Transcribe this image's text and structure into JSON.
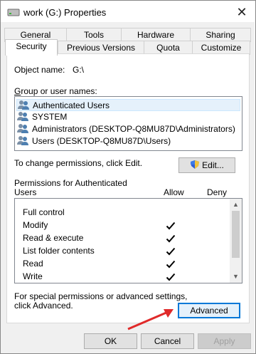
{
  "window": {
    "title": "work (G:) Properties",
    "close_label": "✕"
  },
  "tabs": {
    "row1": [
      "General",
      "Tools",
      "Hardware",
      "Sharing"
    ],
    "row2": [
      "Security",
      "Previous Versions",
      "Quota",
      "Customize"
    ],
    "active": "Security"
  },
  "security": {
    "object_name_label": "Object name:",
    "object_name_value": "G:\\",
    "group_label": "Group or user names:",
    "groups": [
      "Authenticated Users",
      "SYSTEM",
      "Administrators (DESKTOP-Q8MU87D\\Administrators)",
      "Users (DESKTOP-Q8MU87D\\Users)"
    ],
    "change_text": "To change permissions, click Edit.",
    "edit_label": "Edit...",
    "perm_label_line1": "Permissions for Authenticated",
    "perm_label_line2": "Users",
    "allow_header": "Allow",
    "deny_header": "Deny",
    "permissions": [
      {
        "name": "Full control",
        "allow": false,
        "deny": false
      },
      {
        "name": "Modify",
        "allow": true,
        "deny": false
      },
      {
        "name": "Read & execute",
        "allow": true,
        "deny": false
      },
      {
        "name": "List folder contents",
        "allow": true,
        "deny": false
      },
      {
        "name": "Read",
        "allow": true,
        "deny": false
      },
      {
        "name": "Write",
        "allow": true,
        "deny": false
      }
    ],
    "advanced_text_line1": "For special permissions or advanced settings,",
    "advanced_text_line2": "click Advanced.",
    "advanced_label": "Advanced"
  },
  "footer": {
    "ok_label": "OK",
    "cancel_label": "Cancel",
    "apply_label": "Apply"
  },
  "colors": {
    "arrow": "#e02a2a",
    "focus": "#0078d7"
  }
}
